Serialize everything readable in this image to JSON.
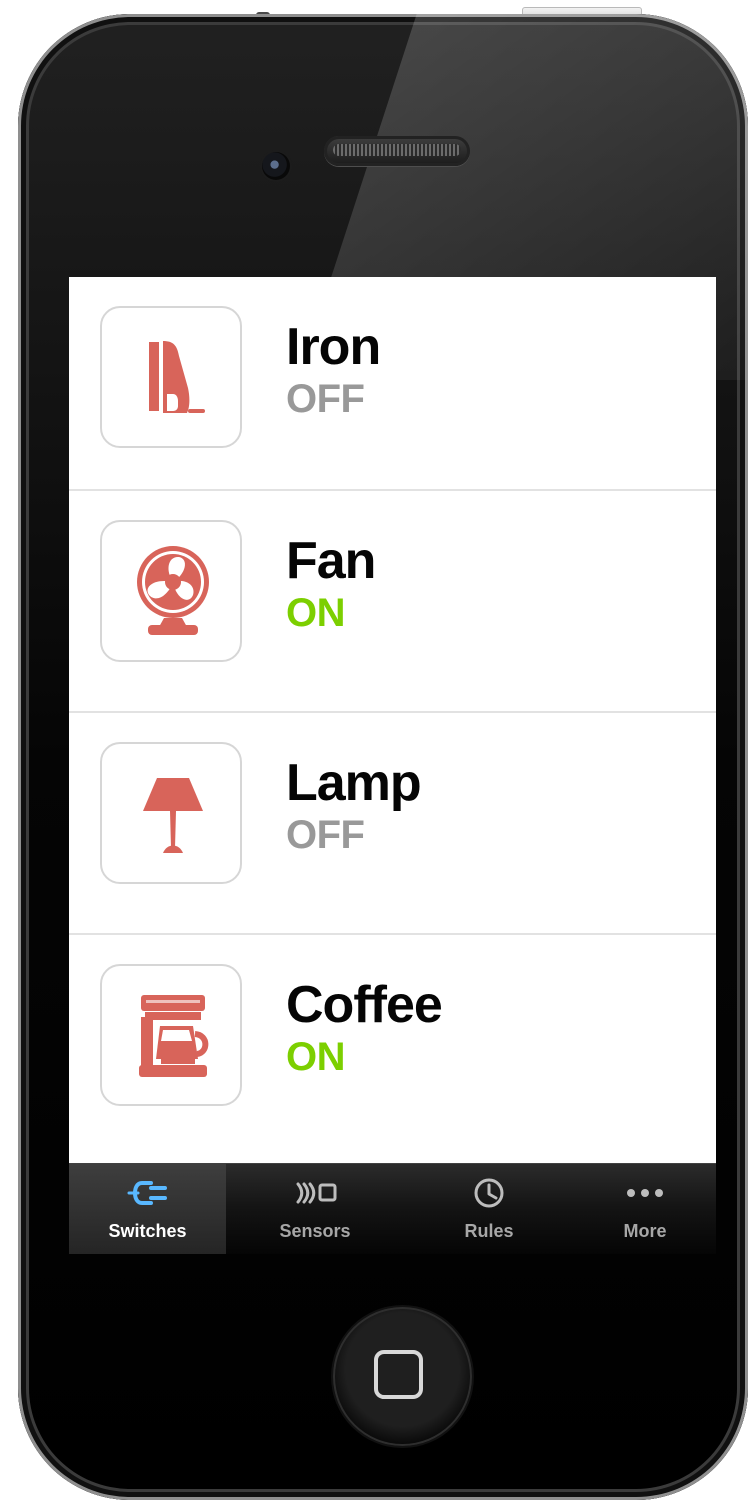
{
  "devices": [
    {
      "name": "Iron",
      "status": "OFF",
      "status_color": "#999999",
      "icon": "iron-icon"
    },
    {
      "name": "Fan",
      "status": "ON",
      "status_color": "#7ccf00",
      "icon": "fan-icon"
    },
    {
      "name": "Lamp",
      "status": "OFF",
      "status_color": "#999999",
      "icon": "lamp-icon"
    },
    {
      "name": "Coffee",
      "status": "ON",
      "status_color": "#7ccf00",
      "icon": "coffee-maker-icon"
    }
  ],
  "tabs": [
    {
      "label": "Switches",
      "icon": "plug-icon",
      "active": true
    },
    {
      "label": "Sensors",
      "icon": "sensor-icon",
      "active": false
    },
    {
      "label": "Rules",
      "icon": "clock-icon",
      "active": false
    },
    {
      "label": "More",
      "icon": "more-dots-icon",
      "active": false
    }
  ],
  "colors": {
    "device_icon": "#d8645a",
    "active_tab_icon": "#59b8ff"
  }
}
